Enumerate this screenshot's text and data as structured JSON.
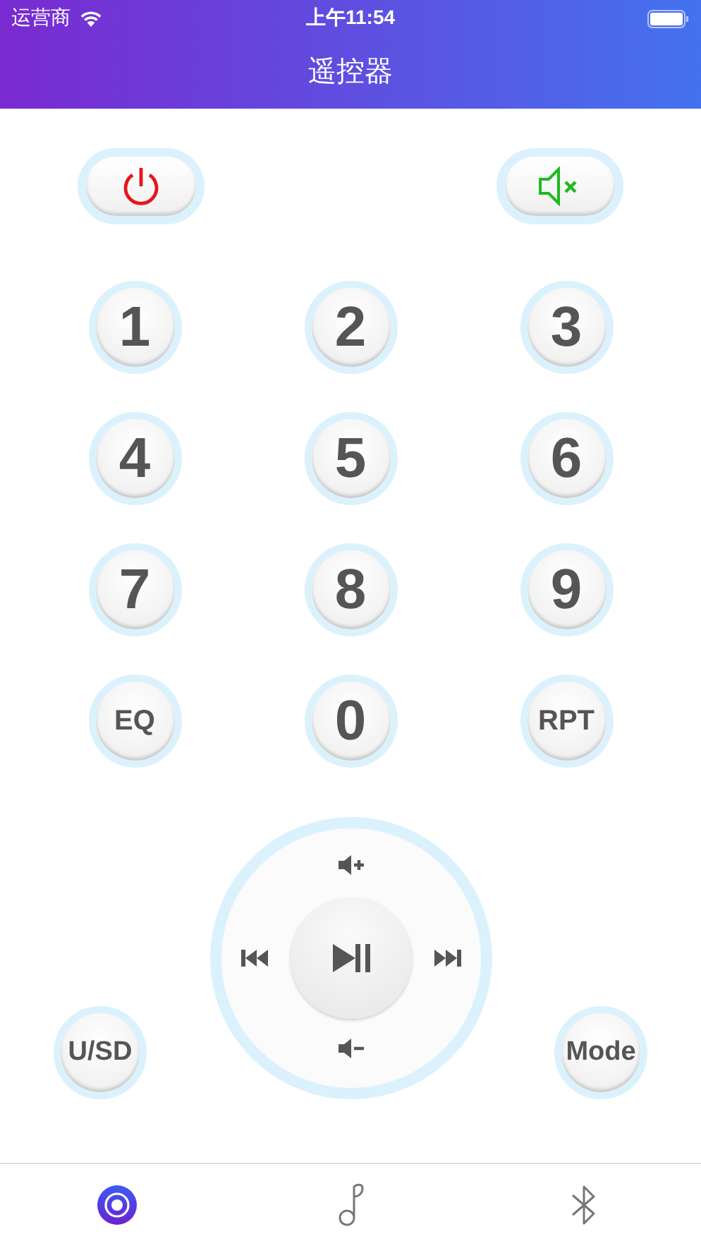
{
  "status_bar": {
    "carrier": "运营商",
    "time": "上午11:54"
  },
  "title": "遥控器",
  "keypad": [
    [
      "1",
      "2",
      "3"
    ],
    [
      "4",
      "5",
      "6"
    ],
    [
      "7",
      "8",
      "9"
    ],
    [
      "EQ",
      "0",
      "RPT"
    ]
  ],
  "side_buttons": [
    "U/SD",
    "Mode"
  ],
  "tabs": [
    {
      "kind": "remote",
      "selected": true
    },
    {
      "kind": "music",
      "selected": false
    },
    {
      "kind": "bluetooth",
      "selected": false
    }
  ]
}
